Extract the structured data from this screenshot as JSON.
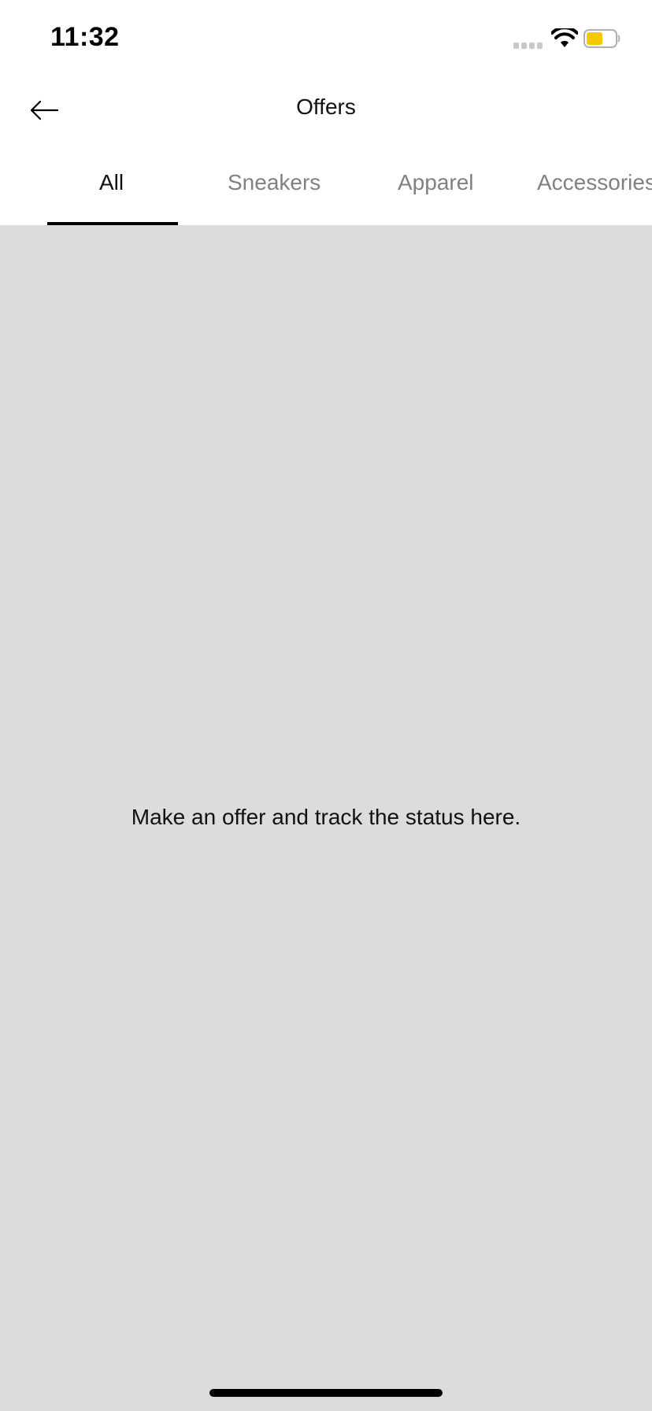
{
  "status_bar": {
    "time": "11:32",
    "icons": [
      "cellular-signal-icon",
      "wifi-icon",
      "battery-icon"
    ],
    "battery_color": "#f6c804"
  },
  "nav": {
    "back_icon": "arrow-left-icon",
    "title": "Offers"
  },
  "tabs": [
    {
      "label": "All",
      "active": true
    },
    {
      "label": "Sneakers",
      "active": false
    },
    {
      "label": "Apparel",
      "active": false
    },
    {
      "label": "Accessories",
      "active": false
    }
  ],
  "empty_state": {
    "message": "Make an offer and track the status here."
  },
  "colors": {
    "background": "#dcdcdc",
    "header": "#ffffff",
    "active_tab": "#111111",
    "inactive_tab": "#808080"
  }
}
